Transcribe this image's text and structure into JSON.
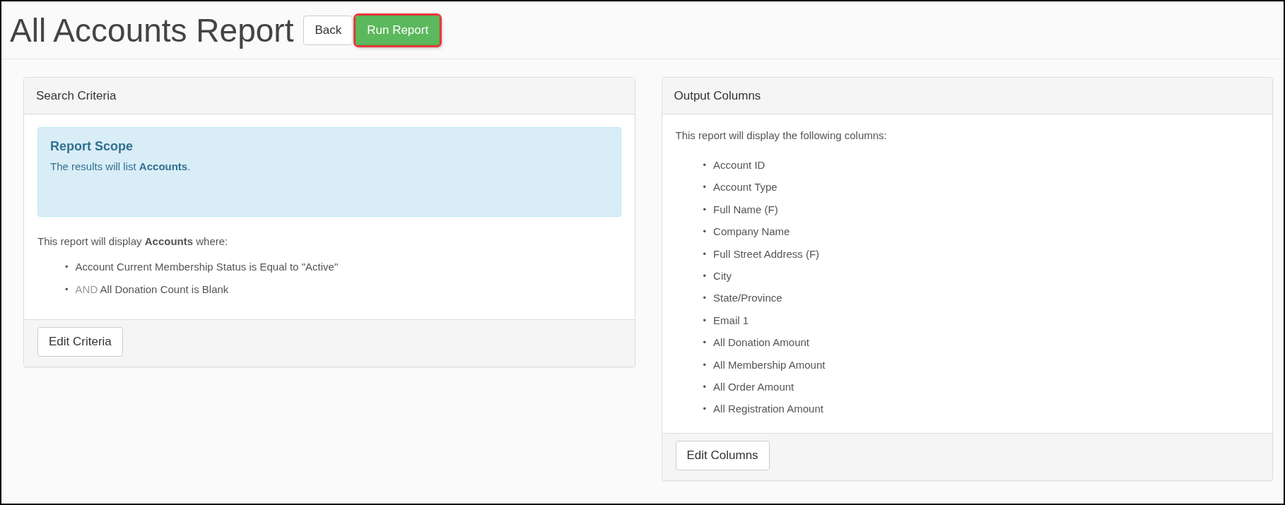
{
  "page": {
    "title": "All Accounts Report"
  },
  "header_buttons": [
    {
      "label": "Back",
      "kind": "default",
      "highlighted": false
    },
    {
      "label": "Run Report",
      "kind": "success",
      "highlighted": true
    }
  ],
  "search_criteria": {
    "heading": "Search Criteria",
    "scope": {
      "title": "Report Scope",
      "text": "The results will list **Accounts**."
    },
    "intro": "This report will display **Accounts** where:",
    "conditions": [
      {
        "marker": "•",
        "text": "Account Current Membership Status is Equal to \"Active\""
      },
      {
        "marker": "•",
        "prefix": "AND",
        "text": "All Donation Count is Blank"
      }
    ],
    "button": "Edit Criteria"
  },
  "output_columns": {
    "heading": "Output Columns",
    "intro": "This report will display the following columns:",
    "columns": [
      {
        "marker": "•",
        "text": "Account ID"
      },
      {
        "marker": "•",
        "text": "Account Type"
      },
      {
        "marker": "•",
        "text": "Full Name (F)"
      },
      {
        "marker": "•",
        "text": "Company Name"
      },
      {
        "marker": "•",
        "text": "Full Street Address (F)"
      },
      {
        "marker": "•",
        "text": "City"
      },
      {
        "marker": "•",
        "text": "State/Province"
      },
      {
        "marker": "•",
        "text": "Email 1"
      },
      {
        "marker": "•",
        "text": "All Donation Amount"
      },
      {
        "marker": "•",
        "text": "All Membership Amount"
      },
      {
        "marker": "•",
        "text": "All Order Amount"
      },
      {
        "marker": "•",
        "text": "All Registration Amount"
      }
    ],
    "button": "Edit Columns"
  }
}
